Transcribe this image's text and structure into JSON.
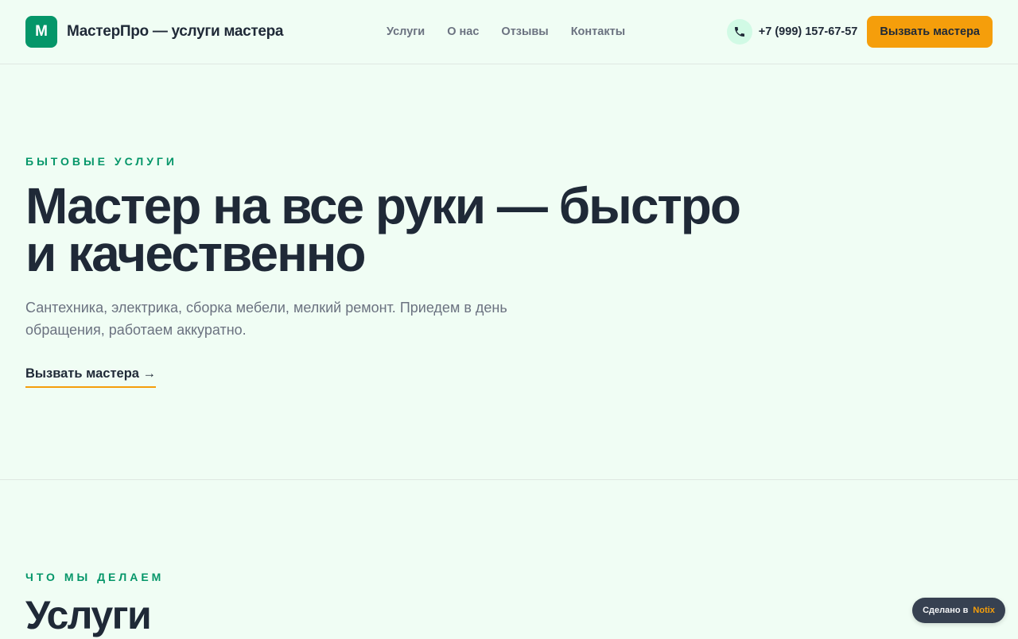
{
  "header": {
    "logo_mark": "М",
    "logo_text": "МастерПро — услуги мастера",
    "nav": [
      "Услуги",
      "О нас",
      "Отзывы",
      "Контакты"
    ],
    "phone_icon": "phone-icon",
    "phone": "+7 (999) 157-67-57",
    "cta": "Вызвать мастера"
  },
  "hero": {
    "eyebrow": "Бытовые услуги",
    "title": "Мастер на все руки — быстро и качественно",
    "subtitle": "Сантехника, электрика, сборка мебели, мелкий ремонт. Приедем в день обращения, работаем аккуратно.",
    "link": "Вызвать мастера →"
  },
  "services": {
    "eyebrow": "Что мы делаем",
    "title": "Услуги"
  },
  "badge": {
    "prefix": "Сделано в",
    "brand": "Notix"
  },
  "colors": {
    "background": "#f0fdf4",
    "primary": "#059669",
    "accent": "#f59e0b",
    "text": "#1f2937",
    "muted": "#6b7280"
  }
}
